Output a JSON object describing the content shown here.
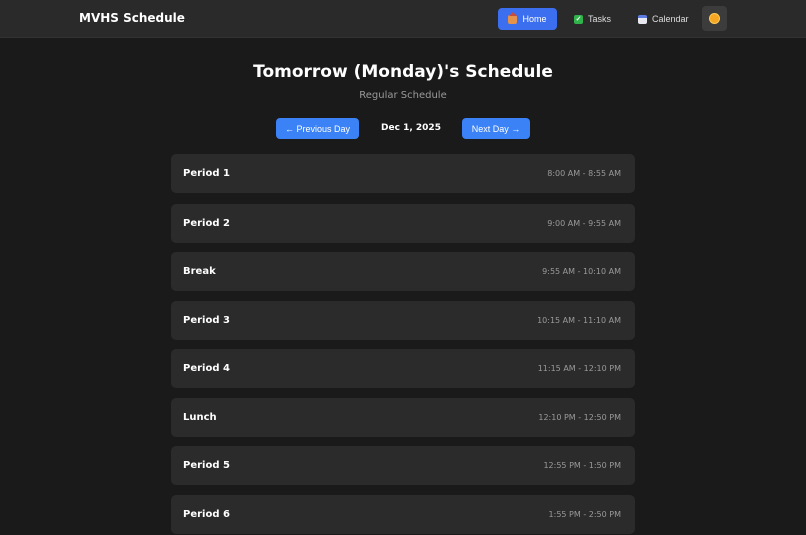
{
  "nav": {
    "brand": "MVHS Schedule",
    "home": "Home",
    "tasks": "Tasks",
    "calendar": "Calendar",
    "icons": {
      "home": "house-icon",
      "tasks": "check-icon",
      "calendar": "calendar-icon",
      "theme": "sun-icon"
    }
  },
  "schedule": {
    "title": "Tomorrow (Monday)'s Schedule",
    "subtitle": "Regular Schedule",
    "prev_label": "← Previous Day",
    "next_label": "Next Day →",
    "date": "Dec 1, 2025",
    "periods": [
      {
        "name": "Period 1",
        "time": "8:00 AM - 8:55 AM"
      },
      {
        "name": "Period 2",
        "time": "9:00 AM - 9:55 AM"
      },
      {
        "name": "Break",
        "time": "9:55 AM - 10:10 AM"
      },
      {
        "name": "Period 3",
        "time": "10:15 AM - 11:10 AM"
      },
      {
        "name": "Period 4",
        "time": "11:15 AM - 12:10 PM"
      },
      {
        "name": "Lunch",
        "time": "12:10 PM - 12:50 PM"
      },
      {
        "name": "Period 5",
        "time": "12:55 PM - 1:50 PM"
      },
      {
        "name": "Period 6",
        "time": "1:55 PM - 2:50 PM"
      }
    ]
  },
  "colors": {
    "background": "#1a1a1a",
    "navbar": "#2a2a2a",
    "accent": "#3b82f6",
    "card": "#2b2b2b",
    "muted_text": "#9a9a9a"
  }
}
